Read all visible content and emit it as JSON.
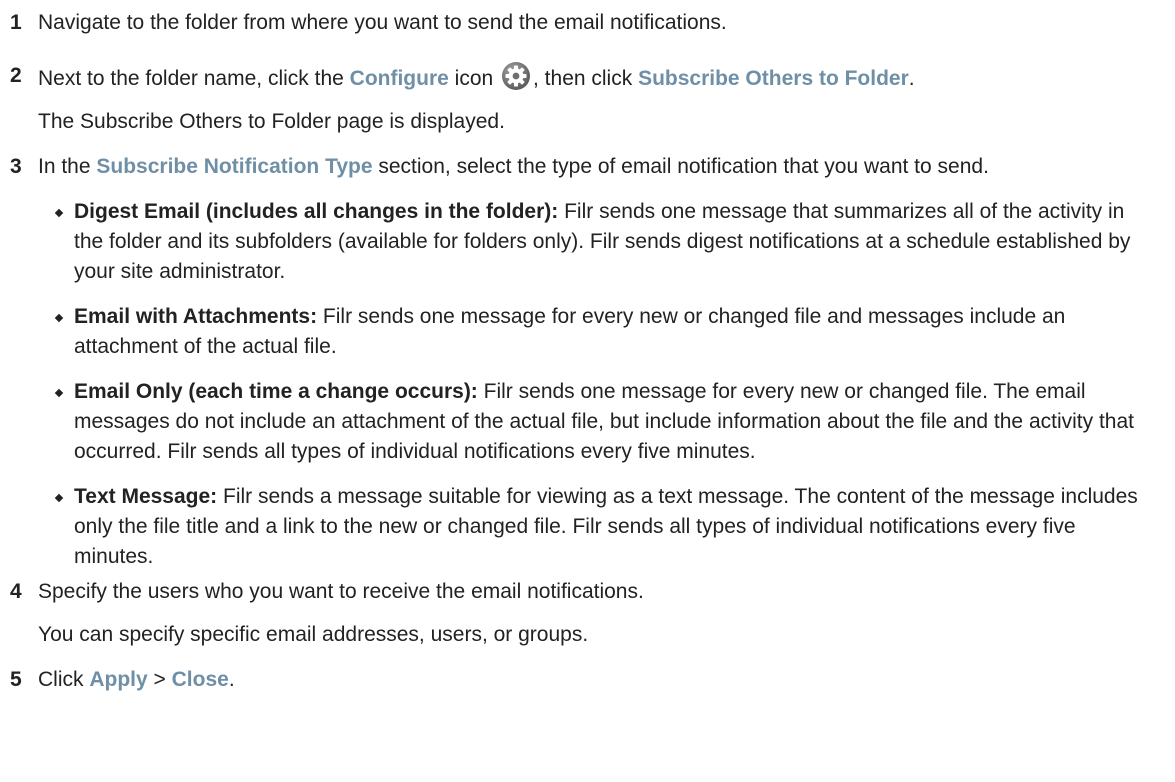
{
  "steps": [
    {
      "number": "1",
      "text": "Navigate to the folder from where you want to send the email notifications."
    },
    {
      "number": "2",
      "text_a": "Next to the folder name, click the ",
      "ui_a": "Configure",
      "text_b": " icon ",
      "text_c": ", then click ",
      "ui_b": "Subscribe Others to Folder",
      "text_d": ".",
      "followup": "The Subscribe Others to Folder page is displayed.",
      "icon": "gear-icon"
    },
    {
      "number": "3",
      "text_a": "In the ",
      "ui_a": "Subscribe Notification Type",
      "text_b": " section, select the type of email notification that you want to send.",
      "bullets": [
        {
          "term": "Digest Email (includes all changes in the folder):",
          "desc": " Filr sends one message that summarizes all of the activity in the folder and its subfolders (available for folders only). Filr sends digest notifications at a schedule established by your site administrator."
        },
        {
          "term": "Email with Attachments:",
          "desc": " Filr sends one message for every new or changed file and messages include an attachment of the actual file."
        },
        {
          "term": "Email Only (each time a change occurs):",
          "desc": " Filr sends one message for every new or changed file. The email messages do not include an attachment of the actual file, but include information about the file and the activity that occurred. Filr sends all types of individual notifications every five minutes."
        },
        {
          "term": "Text Message:",
          "desc": " Filr sends a message suitable for viewing as a text message. The content of the message includes only the file title and a link to the new or changed file. Filr sends all types of individual notifications every five minutes."
        }
      ]
    },
    {
      "number": "4",
      "text": "Specify the users who you want to receive the email notifications.",
      "followup": "You can specify specific email addresses, users, or groups."
    },
    {
      "number": "5",
      "text_a": "Click ",
      "ui_a": "Apply",
      "text_b": " > ",
      "ui_b": "Close",
      "text_c": "."
    }
  ]
}
